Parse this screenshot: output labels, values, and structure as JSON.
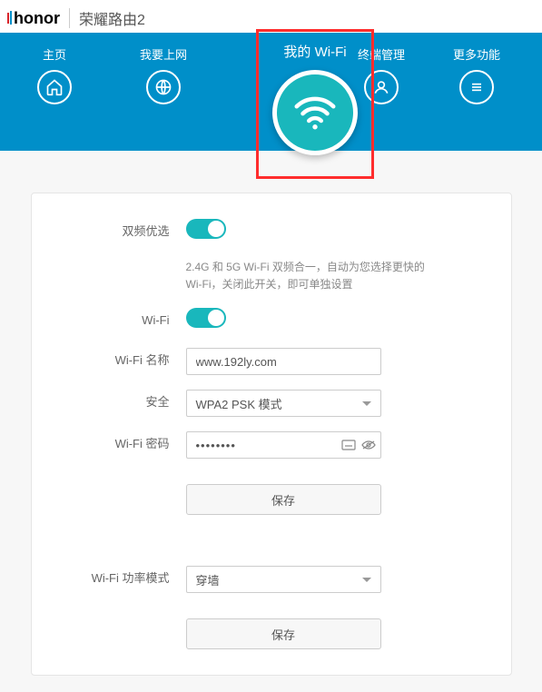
{
  "brand": "honor",
  "product": "荣耀路由2",
  "nav": {
    "home": "主页",
    "internet": "我要上网",
    "wifi": "我的 Wi-Fi",
    "devices": "终端管理",
    "more": "更多功能"
  },
  "form": {
    "dual_band_label": "双频优选",
    "dual_band_help": "2.4G 和 5G Wi-Fi 双频合一，自动为您选择更快的 Wi-Fi，关闭此开关，即可单独设置",
    "wifi_label": "Wi-Fi",
    "ssid_label": "Wi-Fi 名称",
    "ssid_value": "www.192ly.com",
    "security_label": "安全",
    "security_value": "WPA2 PSK 模式",
    "password_label": "Wi-Fi 密码",
    "password_value": "••••••••",
    "save_label": "保存",
    "power_label": "Wi-Fi 功率模式",
    "power_value": "穿墙"
  }
}
